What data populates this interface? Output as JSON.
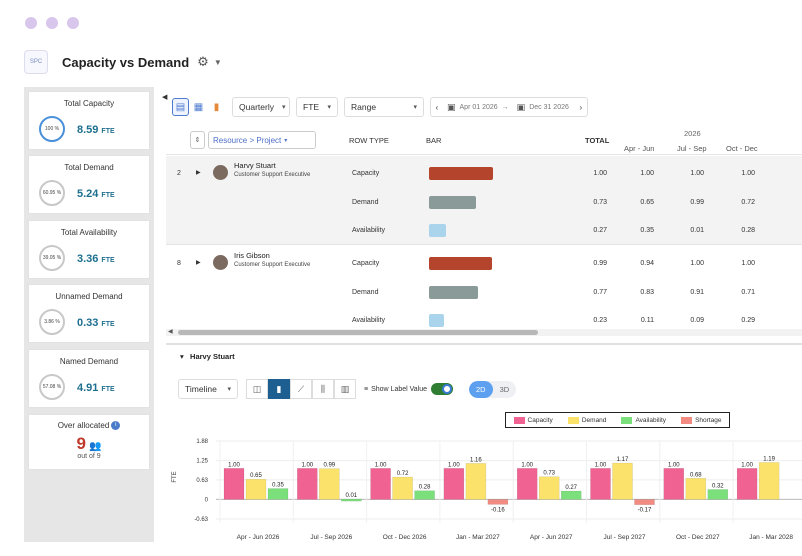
{
  "app": {
    "title": "Capacity vs Demand",
    "logo_text": "SPC"
  },
  "metrics": [
    {
      "label": "Total Capacity",
      "ring": "100 %",
      "value": "8.59",
      "unit": "FTE",
      "ring_color": "#4a90d9"
    },
    {
      "label": "Total Demand",
      "ring": "60.95 %",
      "value": "5.24",
      "unit": "FTE",
      "ring_color": "#c8c8c8"
    },
    {
      "label": "Total Availability",
      "ring": "39.05 %",
      "value": "3.36",
      "unit": "FTE",
      "ring_color": "#c8c8c8"
    },
    {
      "label": "Unnamed Demand",
      "ring": "3.86 %",
      "value": "0.33",
      "unit": "FTE",
      "ring_color": "#c8c8c8"
    },
    {
      "label": "Named Demand",
      "ring": "57.08 %",
      "value": "4.91",
      "unit": "FTE",
      "ring_color": "#c8c8c8"
    }
  ],
  "over_allocated": {
    "label": "Over allocated",
    "count": "9",
    "sub": "out of 9"
  },
  "toolbar": {
    "period": "Quarterly",
    "unit": "FTE",
    "range": "Range",
    "date_from": "Apr 01 2026",
    "date_to": "Dec 31 2026"
  },
  "grid": {
    "group_by": "Resource > Project",
    "headers": {
      "row_type": "ROW TYPE",
      "bar": "BAR",
      "total": "TOTAL",
      "year": "2026"
    },
    "periods": [
      "Apr - Jun",
      "Jul - Sep",
      "Oct - Dec"
    ],
    "people": [
      {
        "index": "2",
        "name": "Harvy Stuart",
        "role": "Customer Support Executive",
        "rows": [
          {
            "type": "Capacity",
            "total": "1.00",
            "vals": [
              "1.00",
              "1.00",
              "1.00"
            ],
            "bar_color": "#b4442c",
            "bar_frac": 1.0
          },
          {
            "type": "Demand",
            "total": "0.73",
            "vals": [
              "0.65",
              "0.99",
              "0.72"
            ],
            "bar_color": "#8a9a98",
            "bar_frac": 0.73
          },
          {
            "type": "Availability",
            "total": "0.27",
            "vals": [
              "0.35",
              "0.01",
              "0.28"
            ],
            "bar_color": "#a9d4ec",
            "bar_frac": 0.27
          }
        ]
      },
      {
        "index": "8",
        "name": "Iris Gibson",
        "role": "Customer Support Executive",
        "rows": [
          {
            "type": "Capacity",
            "total": "0.99",
            "vals": [
              "0.94",
              "1.00",
              "1.00"
            ],
            "bar_color": "#b4442c",
            "bar_frac": 0.99
          },
          {
            "type": "Demand",
            "total": "0.77",
            "vals": [
              "0.83",
              "0.91",
              "0.71"
            ],
            "bar_color": "#8a9a98",
            "bar_frac": 0.77
          },
          {
            "type": "Availability",
            "total": "0.23",
            "vals": [
              "0.11",
              "0.09",
              "0.29"
            ],
            "bar_color": "#a9d4ec",
            "bar_frac": 0.23
          }
        ]
      }
    ]
  },
  "detail": {
    "title": "Harvy Stuart",
    "view": "Timeline",
    "show_label": "Show Label Value",
    "dim_2d": "2D",
    "dim_3d": "3D"
  },
  "chart_data": {
    "type": "bar",
    "ylabel": "FTE",
    "yticks": [
      1.88,
      1.25,
      0.63,
      0,
      -0.63
    ],
    "ylim": [
      -0.63,
      1.88
    ],
    "legend_position": "top",
    "categories": [
      "Apr - Jun 2026",
      "Jul - Sep 2026",
      "Oct - Dec 2026",
      "Jan - Mar 2027",
      "Apr - Jun 2027",
      "Jul - Sep 2027",
      "Oct - Dec 2027",
      "Jan - Mar 2028"
    ],
    "series": [
      {
        "name": "Capacity",
        "color": "#f06292",
        "values": [
          1.0,
          1.0,
          1.0,
          1.0,
          1.0,
          1.0,
          1.0,
          1.0
        ]
      },
      {
        "name": "Demand",
        "color": "#fbe36b",
        "values": [
          0.65,
          0.99,
          0.72,
          1.16,
          0.73,
          1.17,
          0.68,
          1.19
        ]
      },
      {
        "name": "Availability",
        "color": "#7be07b",
        "values": [
          0.35,
          0.01,
          0.28,
          null,
          0.27,
          null,
          0.32,
          null
        ]
      },
      {
        "name": "Shortage",
        "color": "#f28b82",
        "values": [
          null,
          null,
          null,
          -0.16,
          null,
          -0.17,
          null,
          null
        ]
      }
    ]
  }
}
